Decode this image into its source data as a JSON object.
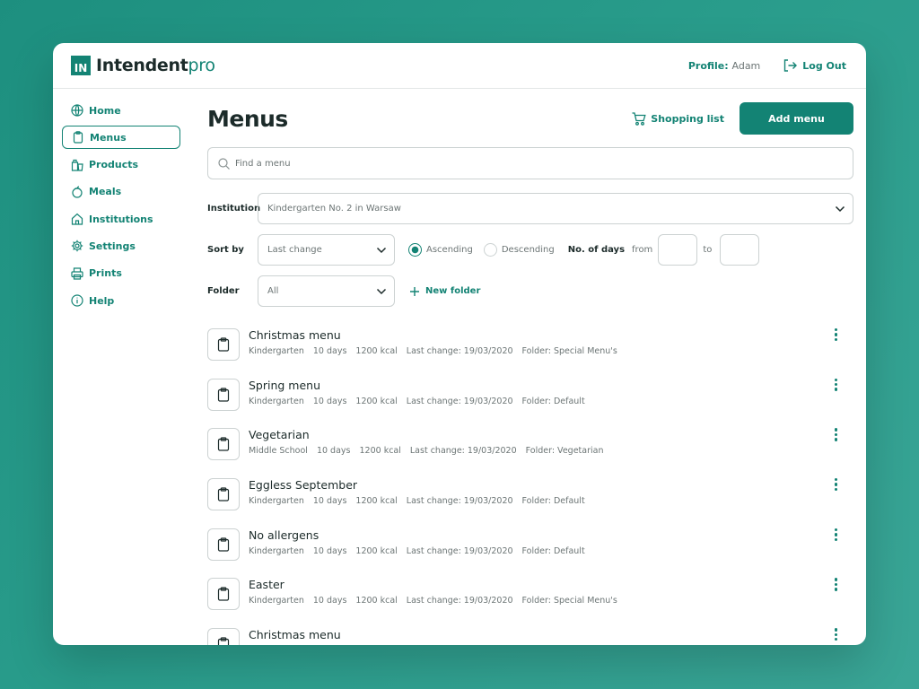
{
  "app": {
    "logo_mark": "IN",
    "logo_name": "Intendent",
    "logo_suffix": "pro"
  },
  "header": {
    "profile_label": "Profile:",
    "profile_user": "Adam",
    "logout_label": "Log Out"
  },
  "sidebar": {
    "items": [
      {
        "label": "Home",
        "icon": "globe-icon",
        "active": false
      },
      {
        "label": "Menus",
        "icon": "clipboard-icon",
        "active": true
      },
      {
        "label": "Products",
        "icon": "products-icon",
        "active": false
      },
      {
        "label": "Meals",
        "icon": "meal-icon",
        "active": false
      },
      {
        "label": "Institutions",
        "icon": "house-icon",
        "active": false
      },
      {
        "label": "Settings",
        "icon": "gear-icon",
        "active": false
      },
      {
        "label": "Prints",
        "icon": "printer-icon",
        "active": false
      },
      {
        "label": "Help",
        "icon": "info-icon",
        "active": false
      }
    ]
  },
  "main": {
    "title": "Menus",
    "shopping_list_label": "Shopping list",
    "add_menu_label": "Add menu",
    "search_placeholder": "Find a menu",
    "institution_label": "Institution",
    "institution_value": "Kindergarten No. 2 in Warsaw",
    "sort_label": "Sort by",
    "sort_value": "Last change",
    "ascending_label": "Ascending",
    "descending_label": "Descending",
    "order_selected": "ascending",
    "days_label": "No. of days",
    "days_from_label": "from",
    "days_to_label": "to",
    "folder_label": "Folder",
    "folder_value": "All",
    "new_folder_label": "New folder"
  },
  "menus": [
    {
      "title": "Christmas menu",
      "type": "Kindergarten",
      "days": "10 days",
      "kcal": "1200 kcal",
      "last_change": "Last change: 19/03/2020",
      "folder": "Folder: Special Menu's"
    },
    {
      "title": "Spring menu",
      "type": "Kindergarten",
      "days": "10 days",
      "kcal": "1200 kcal",
      "last_change": "Last change: 19/03/2020",
      "folder": "Folder: Default"
    },
    {
      "title": "Vegetarian",
      "type": "Middle School",
      "days": "10 days",
      "kcal": "1200 kcal",
      "last_change": "Last change: 19/03/2020",
      "folder": "Folder: Vegetarian"
    },
    {
      "title": "Eggless September",
      "type": "Kindergarten",
      "days": "10 days",
      "kcal": "1200 kcal",
      "last_change": "Last change: 19/03/2020",
      "folder": "Folder: Default"
    },
    {
      "title": "No allergens",
      "type": "Kindergarten",
      "days": "10 days",
      "kcal": "1200 kcal",
      "last_change": "Last change: 19/03/2020",
      "folder": "Folder: Default"
    },
    {
      "title": "Easter",
      "type": "Kindergarten",
      "days": "10 days",
      "kcal": "1200 kcal",
      "last_change": "Last change: 19/03/2020",
      "folder": "Folder: Special Menu's"
    },
    {
      "title": "Christmas menu",
      "type": "",
      "days": "",
      "kcal": "",
      "last_change": "",
      "folder": ""
    }
  ],
  "colors": {
    "accent": "#138374",
    "text": "#1c2b2a",
    "muted": "#6c7575",
    "border": "#ccd2d2",
    "background": "#2a9d8c"
  }
}
